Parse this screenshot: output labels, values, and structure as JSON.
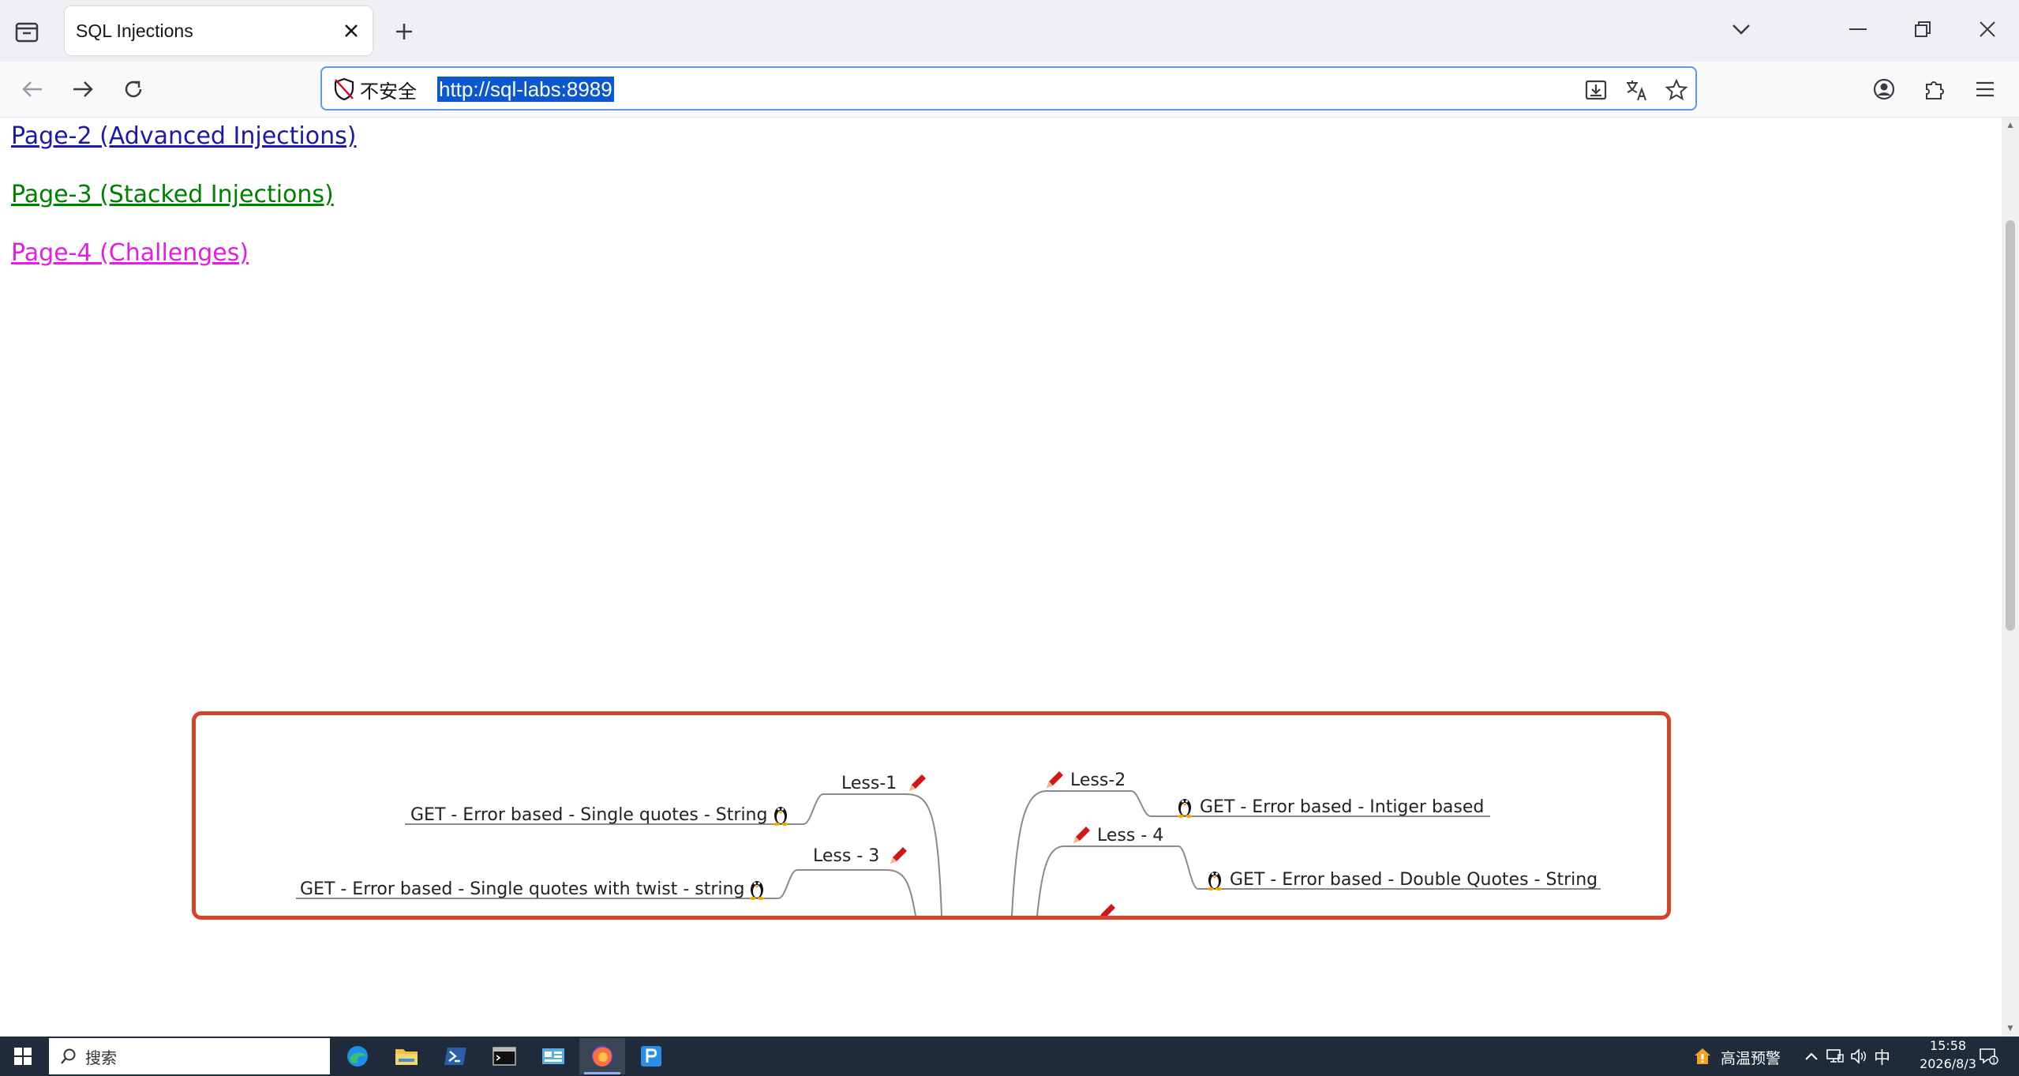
{
  "browser": {
    "tab_title": "SQL Injections",
    "security_label": "不安全",
    "url": "http://sql-labs:8989"
  },
  "page": {
    "links": [
      {
        "label": "Page-2 (Advanced Injections)",
        "color": "#1a1aa6"
      },
      {
        "label": "Page-3 (Stacked Injections)",
        "color": "#008000"
      },
      {
        "label": "Page-4 (Challenges)",
        "color": "#e020e0"
      }
    ],
    "mindmap": {
      "nodes": [
        {
          "label": "Less-1"
        },
        {
          "label": "GET - Error based - Single quotes - String"
        },
        {
          "label": "Less - 3"
        },
        {
          "label": "GET - Error based - Single quotes with twist - string"
        },
        {
          "label": "Less-2"
        },
        {
          "label": "GET - Error based - Intiger based"
        },
        {
          "label": "Less - 4"
        },
        {
          "label": "GET - Error based - Double Quotes - String"
        }
      ],
      "frame_color": "#d4432c"
    }
  },
  "taskbar": {
    "search_label": "搜索",
    "weather_label": "高温预警",
    "ime_label": "中",
    "time": "15:58",
    "date": "2026/8/3"
  }
}
